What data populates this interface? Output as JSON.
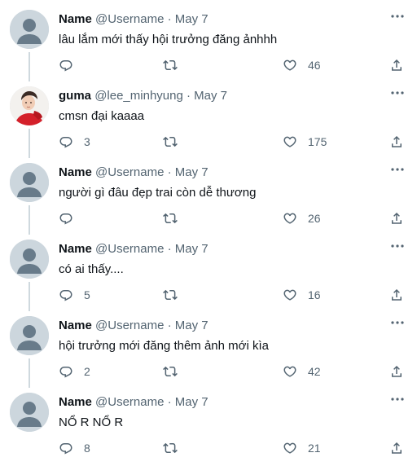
{
  "tweets": [
    {
      "name": "Name",
      "handle": "@Username",
      "sep": "·",
      "date": "May 7",
      "text": "lâu lắm mới thấy hội trưởng đăng ảnhhh",
      "reply_count": "",
      "like_count": "46",
      "avatar": "default-avatar-icon"
    },
    {
      "name": "guma",
      "handle": "@lee_minhyung",
      "sep": "·",
      "date": "May 7",
      "text": "cmsn đại kaaaa",
      "reply_count": "3",
      "like_count": "175",
      "avatar": "profile-photo"
    },
    {
      "name": "Name",
      "handle": "@Username",
      "sep": "·",
      "date": "May 7",
      "text": "người gì đâu đẹp trai còn dễ thương",
      "reply_count": "",
      "like_count": "26",
      "avatar": "default-avatar-icon"
    },
    {
      "name": "Name",
      "handle": "@Username",
      "sep": "·",
      "date": "May 7",
      "text": "có ai thấy....",
      "reply_count": "5",
      "like_count": "16",
      "avatar": "default-avatar-icon"
    },
    {
      "name": "Name",
      "handle": "@Username",
      "sep": "·",
      "date": "May 7",
      "text": "hội trưởng mới đăng thêm ảnh mới kìa",
      "reply_count": "2",
      "like_count": "42",
      "avatar": "default-avatar-icon"
    },
    {
      "name": "Name",
      "handle": "@Username",
      "sep": "·",
      "date": "May 7",
      "text": "NỔ R NỔ R",
      "reply_count": "8",
      "like_count": "21",
      "avatar": "default-avatar-icon"
    }
  ],
  "colors": {
    "text": "#0f1419",
    "muted": "#536471",
    "thread_line": "#cfd9de",
    "avatar_bg": "#ccd6dd",
    "avatar_fg": "#687b8a",
    "photo_red": "#d4202a"
  },
  "icons": [
    "reply-icon",
    "retweet-icon",
    "like-icon",
    "share-icon",
    "more-icon"
  ]
}
